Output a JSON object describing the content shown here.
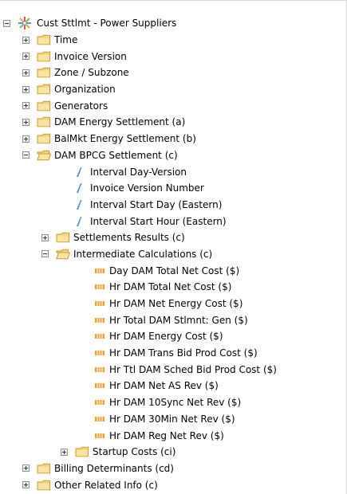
{
  "tree": {
    "root": {
      "label": "Cust Sttlmt - Power Suppliers",
      "icon": "cube-star-icon"
    },
    "folders_top": [
      {
        "name": "time",
        "label": "Time"
      },
      {
        "name": "invoice-version",
        "label": "Invoice Version"
      },
      {
        "name": "zone-subzone",
        "label": "Zone / Subzone"
      },
      {
        "name": "organization",
        "label": "Organization"
      },
      {
        "name": "generators",
        "label": "Generators"
      },
      {
        "name": "dam-energy-settlement",
        "label": "DAM Energy Settlement (a)"
      },
      {
        "name": "balmkt-energy-settlement",
        "label": "BalMkt Energy Settlement (b)"
      }
    ],
    "dam_bpcg": {
      "label": "DAM BPCG Settlement (c)",
      "attributes": [
        "Interval Day-Version",
        "Invoice Version Number",
        "Interval Start Day (Eastern)",
        "Interval Start Hour (Eastern)"
      ],
      "settlements_results": "Settlements Results (c)",
      "intermediate": {
        "label": "Intermediate Calculations (c)",
        "metrics": [
          "Day DAM Total Net Cost ($)",
          "Hr DAM Total Net Cost ($)",
          "Hr DAM Net Energy Cost ($)",
          "Hr Total DAM Stlmnt: Gen ($)",
          "Hr DAM Energy Cost ($)",
          "Hr DAM Trans Bid Prod Cost ($)",
          "Hr Ttl DAM Sched Bid Prod Cost ($)",
          "Hr DAM Net AS Rev ($)",
          "Hr DAM 10Sync Net Rev ($)",
          "Hr DAM 30Min Net Rev ($)",
          "Hr DAM Reg Net Rev ($)"
        ],
        "startup_costs": "Startup Costs (ci)"
      }
    },
    "folders_bottom": [
      {
        "name": "billing-determinants",
        "label": "Billing Determinants (cd)"
      },
      {
        "name": "other-related-info",
        "label": "Other Related Info (c)"
      }
    ]
  },
  "colors": {
    "folder_fill": "#f6d27a",
    "folder_edge": "#c89a2e",
    "attribute_blue": "#4a90d9",
    "metric_orange": "#f0a030"
  }
}
